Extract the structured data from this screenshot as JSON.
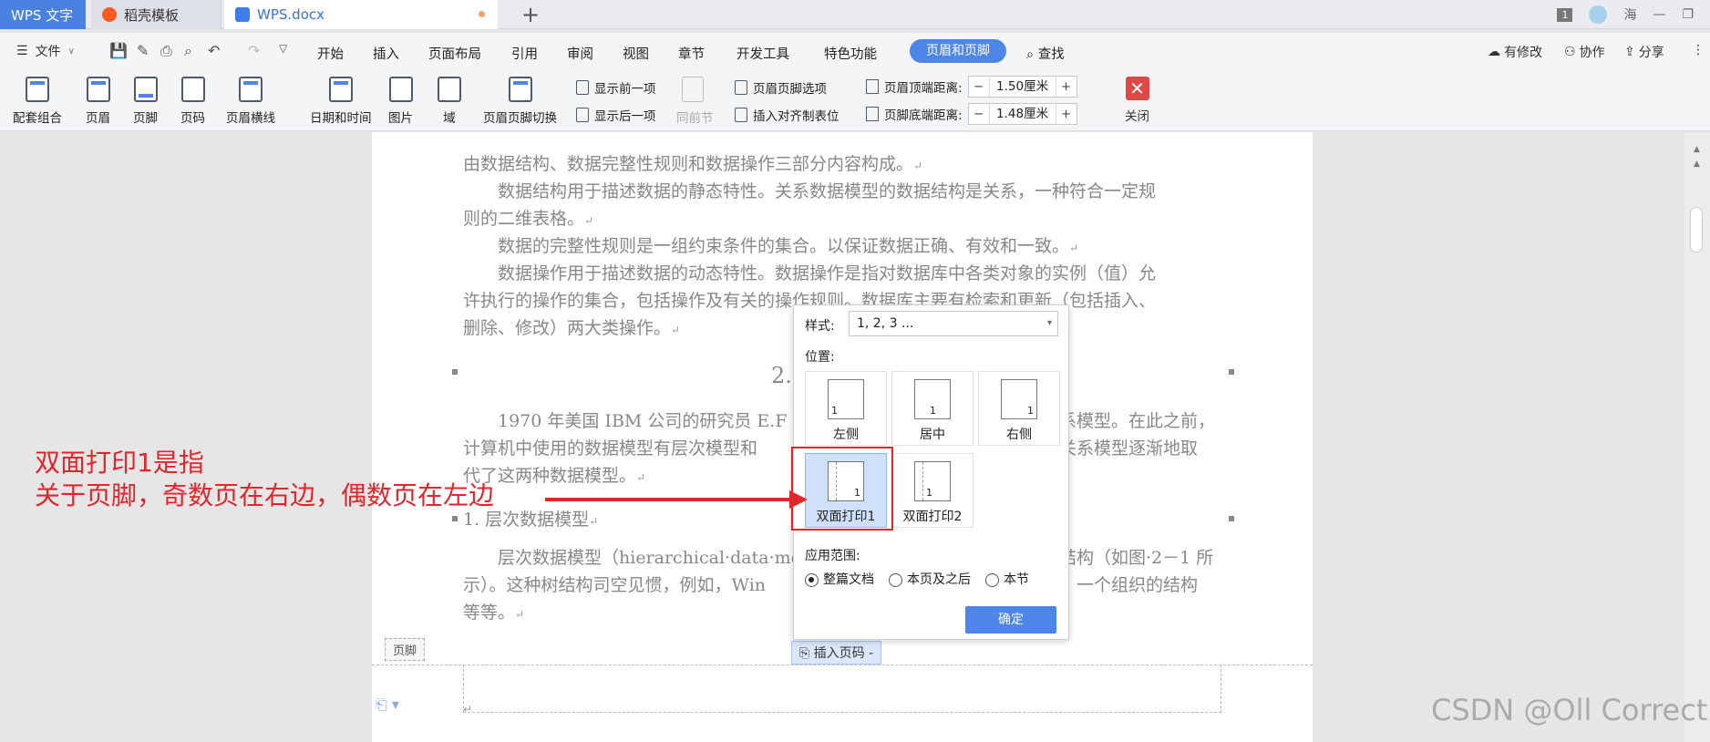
{
  "tabs": [
    {
      "label": "WPS 文字"
    },
    {
      "label": "稻壳模板"
    },
    {
      "label": "WPS.docx"
    }
  ],
  "window": {
    "badge": "1",
    "user": "海"
  },
  "menubar": {
    "file": "文件",
    "items": [
      "开始",
      "插入",
      "页面布局",
      "引用",
      "审阅",
      "视图",
      "章节",
      "开发工具",
      "特色功能"
    ],
    "active": "页眉和页脚",
    "search": "查找",
    "right": [
      "有修改",
      "协作",
      "分享"
    ]
  },
  "toolbar": {
    "peitao": "配套组合",
    "yemei": "页眉",
    "yejiao": "页脚",
    "yema": "页码",
    "yemeihengxian": "页眉横线",
    "datetime": "日期和时间",
    "picture": "图片",
    "field": "域",
    "switch": "页眉页脚切换",
    "show_prev": "显示前一项",
    "show_next": "显示后一项",
    "same_prev": "同前节",
    "hf_options": "页眉页脚选项",
    "insert_align_tab": "插入对齐制表位",
    "header_top_label": "页眉顶端距离:",
    "header_top_value": "1.50厘米",
    "footer_bottom_label": "页脚底端距离:",
    "footer_bottom_value": "1.48厘米",
    "close": "关闭"
  },
  "document": {
    "p0": "由数据结构、数据完整性规则和数据操作三部分内容构成。",
    "p1a": "数据结构用于描述数据的静态特性。关系数据模型的数据结构是关系，一种符合一定规",
    "p1b": "则的二维表格。",
    "p2": "数据的完整性规则是一组约束条件的集合。以保证数据正确、有效和一致。",
    "p3a": "数据操作用于描述数据的动态特性。数据操作是指对数据库中各类对象的实例（值）允",
    "p3b": "许执行的操作的集合，包括操作及有关的操作规则。数据库主要有检索和更新（包括插入、",
    "p3c": "删除、修改）两大类操作。",
    "heading": "2.",
    "p4a": "1970 年美国 IBM 公司的研究员 E.F",
    "p4a_end": "系模型。在此之前，",
    "p4b": "计算机中使用的数据模型有层次模型和",
    "p4b_end": "关系模型逐渐地取",
    "p4c": "代了这两种数据模型。",
    "sub": "1. 层次数据模型",
    "p5a": "层次数据模型（hierarchical·data·moc",
    "p5a_end": "结构（如图·2－1 所",
    "p5b": "示）。这种树结构司空见惯，例如，Win",
    "p5b_end": "、一个组织的结构",
    "p5c": "等等。",
    "footer_tag": "页脚",
    "insert_page_num": "插入页码"
  },
  "popup": {
    "style_label": "样式:",
    "style_value": "1, 2, 3 ...",
    "position_label": "位置:",
    "positions": [
      "左侧",
      "居中",
      "右侧",
      "双面打印1",
      "双面打印2"
    ],
    "page_digit": "1",
    "scope_label": "应用范围:",
    "scope_options": [
      "整篇文档",
      "本页及之后",
      "本节"
    ],
    "selected_scope": "整篇文档",
    "ok": "确定"
  },
  "annotation": {
    "line1": "双面打印1是指",
    "line2": "关于页脚，奇数页在右边，偶数页在左边"
  },
  "watermark": "CSDN @Oll Correct",
  "colors": {
    "accent": "#4d86e8",
    "annotation": "#e3262b",
    "close": "#e04848"
  }
}
